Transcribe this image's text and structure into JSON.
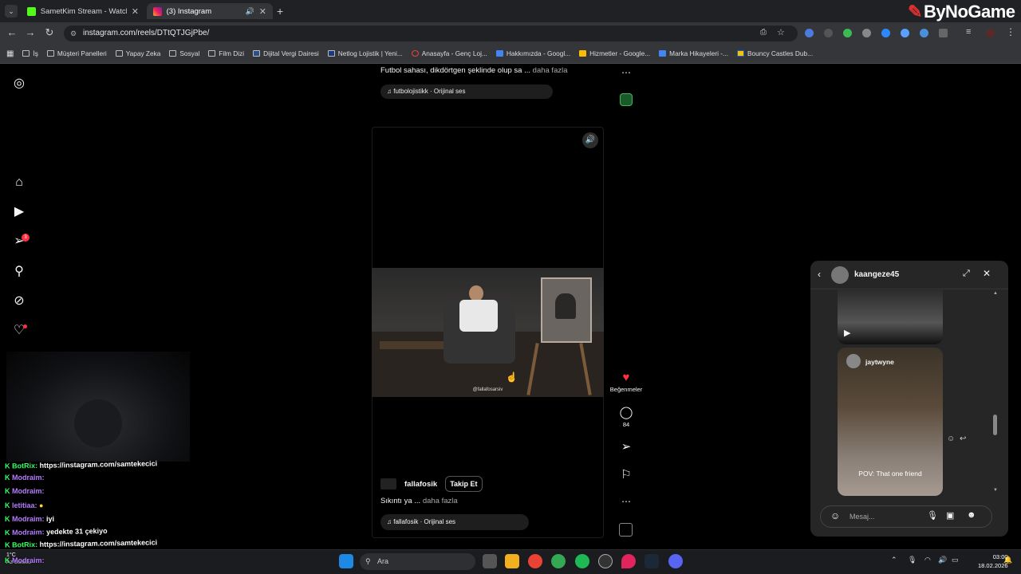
{
  "tabs": [
    {
      "title": "SametKim Stream - Watch Live",
      "active": false
    },
    {
      "title": "(3) Instagram",
      "active": true
    }
  ],
  "url": "instagram.com/reels/DTtQTJGjPbe/",
  "bookmarks": [
    "İş",
    "Müşteri Panelleri",
    "Yapay Zeka",
    "Sosyal",
    "Film Dizi",
    "Dijital Vergi Dairesi",
    "Netlog Lojistik | Yeni...",
    "Anasayfa - Genç Loj...",
    "Hakkımızda - Googl...",
    "Hizmetler - Google...",
    "Marka Hikayeleri -...",
    "Bouncy Castles Dub..."
  ],
  "logo": "ByNoGame",
  "sidebar": {
    "notification_badge": "3"
  },
  "reel_top": {
    "caption": "Futbol sahası, dikdörtgen şeklinde olup sa ...",
    "more": "daha fazla",
    "audio": "futbolojistikk · Orijinal ses"
  },
  "reel": {
    "watermark": "@fallafosarsiv",
    "author": "fallafosik",
    "follow_label": "Takip Et",
    "caption": "Sıkıntı ya ...",
    "more": "daha fazla",
    "audio": "fallafosik · Orijinal ses"
  },
  "actions": {
    "likes_label": "Beğenmeler",
    "comments_count": "84"
  },
  "dm": {
    "username": "kaangeze45",
    "post_author": "jaytwyne",
    "post_caption": "POV: That one friend",
    "input_placeholder": "Mesaj..."
  },
  "chat": [
    {
      "user": "BotRix:",
      "text": "https://instagram.com/samtekecici"
    },
    {
      "user": "Modraim:",
      "text": ""
    },
    {
      "user": "Modraim:",
      "text": ""
    },
    {
      "user": "letitiaa:",
      "text": ""
    },
    {
      "user": "Modraim:",
      "text": "iyi"
    },
    {
      "user": "Modraim:",
      "text": "yedekte 31 çekiyo"
    },
    {
      "user": "BotRix:",
      "text": "https://instagram.com/samtekecici"
    },
    {
      "user": "Modraim:",
      "text": ""
    }
  ],
  "taskbar": {
    "search_label": "Ara",
    "time": "03:00",
    "date": "18.02.2026",
    "weather_temp": "1°C",
    "weather_desc": "Az bulutlu"
  }
}
